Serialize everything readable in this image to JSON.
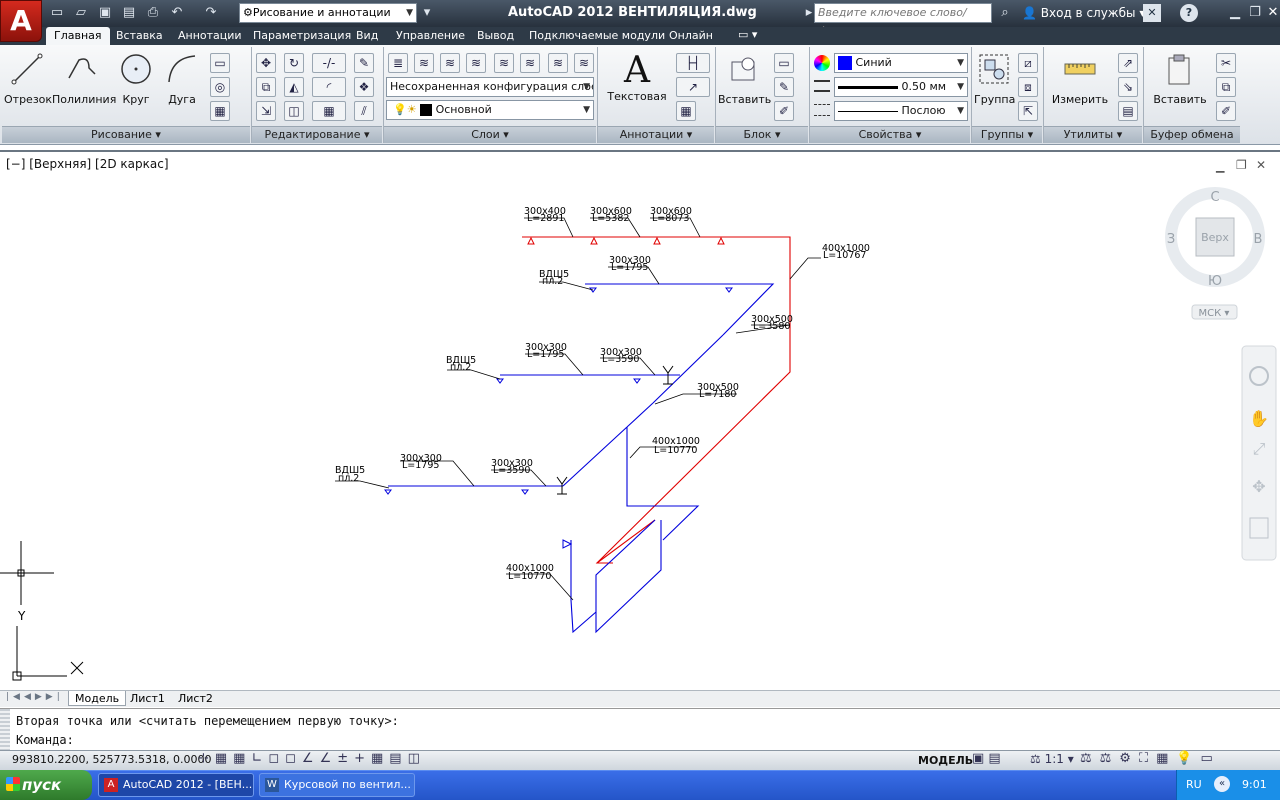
{
  "titlebar": {
    "workspace": "Рисование и аннотации",
    "app_title": "AutoCAD 2012    ВЕНТИЛЯЦИЯ.dwg",
    "search_placeholder": "Введите ключевое слово/фразу",
    "login": "Вход в службы",
    "help": "?"
  },
  "ribbon_tabs": [
    "Главная",
    "Вставка",
    "Аннотации",
    "Параметризация",
    "Вид",
    "Управление",
    "Вывод",
    "Подключаемые модули",
    "Онлайн"
  ],
  "ribbon": {
    "draw": {
      "line": "Отрезок",
      "polyline": "Полилиния",
      "circle": "Круг",
      "arc": "Дуга",
      "panel": "Рисование"
    },
    "modify": {
      "panel": "Редактирование"
    },
    "layers": {
      "config": "Несохраненная конфигурация слоев",
      "current": "Основной",
      "panel": "Слои"
    },
    "annotation": {
      "text": "Текстовая",
      "panel": "Аннотации"
    },
    "block": {
      "insert": "Вставить",
      "panel": "Блок"
    },
    "properties": {
      "color": "Синий",
      "lineweight": "0.50 мм",
      "linetype": "Послою",
      "panel": "Свойства"
    },
    "groups": {
      "group": "Группа",
      "panel": "Группы"
    },
    "utilities": {
      "measure": "Измерить",
      "panel": "Утилиты"
    },
    "clipboard": {
      "paste": "Вставить",
      "panel": "Буфер обмена"
    }
  },
  "viewport_label": "[−] [Верхняя] [2D каркас]",
  "viewcube": {
    "north": "С",
    "south": "Ю",
    "west": "З",
    "east": "В",
    "face": "Верх",
    "ucs": "МСК ▾"
  },
  "ucs": {
    "x": "X",
    "y": "Y"
  },
  "drawing_labels": [
    {
      "id": "d1",
      "lines": [
        "300x400",
        "L=2891"
      ]
    },
    {
      "id": "d2",
      "lines": [
        "300x600",
        "L=5382"
      ]
    },
    {
      "id": "d3",
      "lines": [
        "300x600",
        "L=8073"
      ]
    },
    {
      "id": "d4",
      "lines": [
        "400x1000",
        "L=10767"
      ]
    },
    {
      "id": "d5",
      "lines": [
        "ВДШ5",
        "пл.2"
      ]
    },
    {
      "id": "d6",
      "lines": [
        "300x300",
        "L=1795"
      ]
    },
    {
      "id": "d7",
      "lines": [
        "300x500",
        "L=3580"
      ]
    },
    {
      "id": "d8",
      "lines": [
        "ВДШ5",
        "пл.2"
      ]
    },
    {
      "id": "d9",
      "lines": [
        "300x300",
        "L=1795"
      ]
    },
    {
      "id": "d10",
      "lines": [
        "300x300",
        "L=3590"
      ]
    },
    {
      "id": "d11",
      "lines": [
        "300x500",
        "L=7180"
      ]
    },
    {
      "id": "d12",
      "lines": [
        "400x1000",
        "L=10770"
      ]
    },
    {
      "id": "d13",
      "lines": [
        "ВДШ5",
        "пл.2"
      ]
    },
    {
      "id": "d14",
      "lines": [
        "300x300",
        "L=1795"
      ]
    },
    {
      "id": "d15",
      "lines": [
        "300x300",
        "L=3590"
      ]
    },
    {
      "id": "d16",
      "lines": [
        "400x1000",
        "L=10770"
      ]
    }
  ],
  "layout_tabs": [
    "Модель",
    "Лист1",
    "Лист2"
  ],
  "command": {
    "history": "Вторая точка или <считать перемещением первую точку>:",
    "prompt": "Команда:"
  },
  "status": {
    "coords": "993810.2200, 525773.5318, 0.0000",
    "model": "МОДЕЛЬ",
    "scale": "1:1"
  },
  "taskbar": {
    "start": "пуск",
    "tasks": [
      "AutoCAD 2012 - [ВЕН...",
      "Курсовой по вентил..."
    ],
    "lang": "RU",
    "time": "9:01"
  },
  "colors": {
    "red": "#e00000",
    "blue": "#0000dd",
    "accent": "#2b579a"
  }
}
